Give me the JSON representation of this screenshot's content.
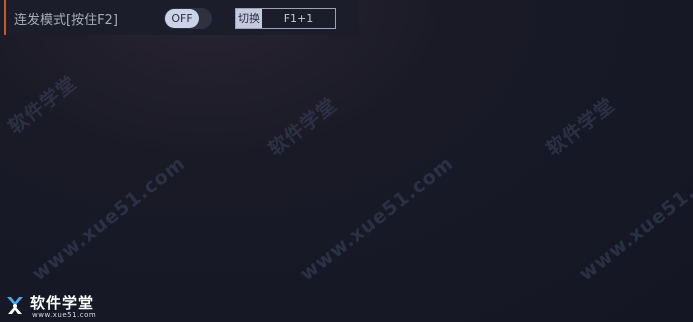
{
  "toolbar": {
    "mode_label": "连发模式[按住F2]",
    "toggle_state": "OFF",
    "switch_label": "切换",
    "switch_key": "F1+1"
  },
  "watermark": {
    "brand": "软件学堂",
    "url": "www.xue51.com"
  },
  "logo": {
    "name": "软件学堂",
    "url": "www.xue51.com"
  },
  "colors": {
    "accent": "#c85a2a",
    "background": "#161826",
    "toggle_knob": "#cdd3e6"
  }
}
